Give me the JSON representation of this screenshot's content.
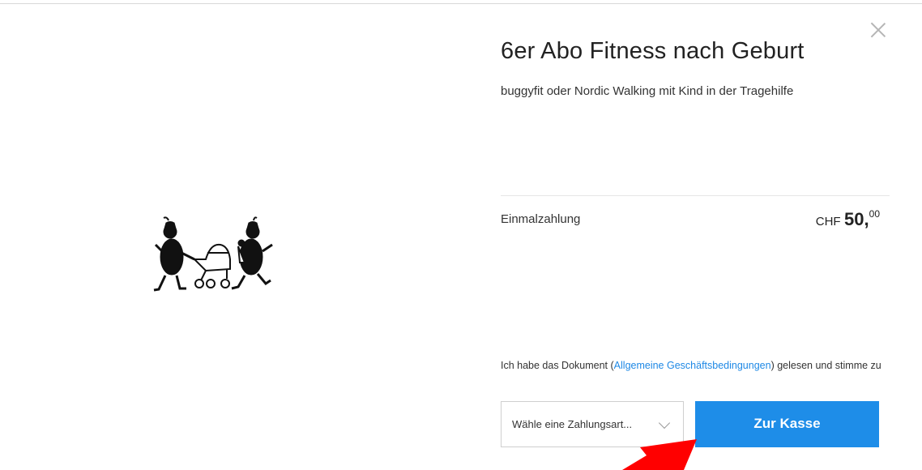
{
  "product": {
    "title": "6er Abo Fitness nach Geburt",
    "subtitle": "buggyfit oder Nordic Walking mit Kind in der Tragehilfe"
  },
  "payment": {
    "label": "Einmalzahlung",
    "currency": "CHF",
    "amount_main": "50,",
    "amount_cents": "00"
  },
  "terms": {
    "prefix": "Ich habe das Dokument (",
    "link_text": "Allgemeine Geschäftsbedingungen",
    "suffix": ") gelesen und stimme zu"
  },
  "payment_select": {
    "value": "Wähle eine Zahlungsart..."
  },
  "checkout": {
    "label": "Zur Kasse"
  },
  "colors": {
    "accent": "#1e8de8",
    "link": "#1e88e5",
    "annotation_arrow": "#ff0000"
  },
  "icons": {
    "close": "close-icon",
    "dropdown": "chevron-down-icon"
  }
}
